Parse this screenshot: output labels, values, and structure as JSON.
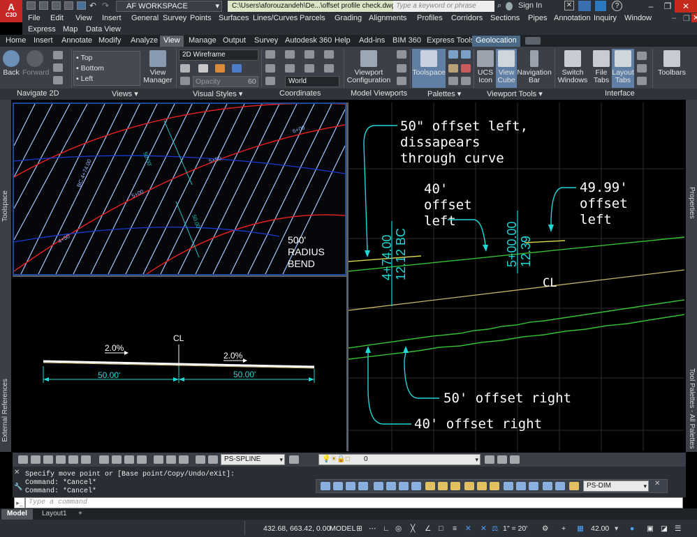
{
  "app": {
    "logo_title": "A",
    "logo_sub": "C3D",
    "workspace": "AF WORKSPACE",
    "file_path": "C:\\Users\\aforouzandeh\\De...\\offset profile check.dwg",
    "search_placeholder": "Type a keyword or phrase",
    "sign_in": "Sign In",
    "help": "?",
    "minimize": "–",
    "restore": "❐",
    "close": "✕"
  },
  "menubar": {
    "row1": [
      "File",
      "Edit",
      "View",
      "Insert",
      "General",
      "Survey",
      "Points",
      "Surfaces",
      "Lines/Curves",
      "Parcels",
      "Grading",
      "Alignments",
      "Profiles",
      "Corridors",
      "Sections",
      "Pipes",
      "Annotation",
      "Inquiry",
      "Window"
    ],
    "row2": [
      "Express",
      "Map",
      "Data View"
    ]
  },
  "ribbon_tabs": [
    "Home",
    "Insert",
    "Annotate",
    "Modify",
    "Analyze",
    "View",
    "Manage",
    "Output",
    "Survey",
    "Autodesk 360",
    "Help",
    "Add-ins",
    "BIM 360",
    "Express Tools",
    "Geolocation"
  ],
  "active_tab": "View",
  "ribbon": {
    "back": "Back",
    "forward": "Forward",
    "views": [
      "Top",
      "Bottom",
      "Left"
    ],
    "view_manager": "View Manager",
    "visual_style": "2D Wireframe",
    "opacity_label": "Opacity",
    "opacity_value": "60",
    "ucs_world": "World",
    "viewport_config": "Viewport Configuration",
    "toolspace": "Toolspace",
    "ucs_icon": "UCS Icon",
    "view_cube": "View Cube",
    "navigation_bar": "Navigation Bar",
    "switch_windows": "Switch Windows",
    "file_tabs": "File Tabs",
    "layout_tabs": "Layout Tabs",
    "toolbars": "Toolbars"
  },
  "panels": [
    "Navigate 2D",
    "Views ▾",
    "Visual Styles ▾",
    "Coordinates",
    "Model Viewports",
    "Palettes ▾",
    "Viewport Tools ▾",
    "Interface"
  ],
  "palettes": {
    "left_top": "Toolspace",
    "left_bottom": "External References",
    "right_top": "Properties",
    "right_bottom": "Tool Palettes - All Palettes"
  },
  "viewport_plan": {
    "labels": [
      "6+00",
      "5+50",
      "50.00'",
      "5+00",
      "50.00'",
      "4+50",
      "BC 4+74.00"
    ],
    "note": [
      "500'",
      "RADIUS",
      "BEND"
    ]
  },
  "viewport_section": {
    "cl": "CL",
    "slope_left": "2.0%",
    "slope_right": "2.0%",
    "dim_left": "50.00'",
    "dim_right": "50.00'"
  },
  "viewport_profile": {
    "note_top": [
      "50\" offset left,",
      "dissapears",
      "through curve"
    ],
    "note_40": [
      "40'",
      "offset",
      "left"
    ],
    "note_49": [
      "49.99'",
      "offset",
      "left"
    ],
    "sta1": [
      "4+74.00",
      "12.12 BC"
    ],
    "sta2": [
      "5+00.00",
      "12.39"
    ],
    "cl": "CL",
    "note_50r": "50' offset right",
    "note_40r": "40' offset right"
  },
  "toolbar1": {
    "layer_style": "PS-SPLINE",
    "layer": "0"
  },
  "command": {
    "history": [
      "Specify move point or [Base point/Copy/Undo/eXit]:",
      "Command: *Cancel*",
      "Command: *Cancel*"
    ],
    "placeholder": "Type a command",
    "dim_style": "PS-DIM"
  },
  "layout_tabs": [
    "Model",
    "Layout1",
    "+"
  ],
  "status": {
    "coords": "432.68, 663.42, 0.00",
    "model": "MODEL",
    "scale": "1\" = 20'",
    "elevation": "42.00"
  }
}
